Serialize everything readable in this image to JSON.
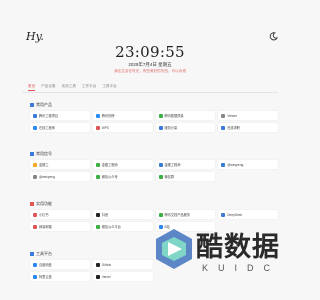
{
  "header": {
    "logo_text": "Hy.",
    "theme_icon": "moon-icon",
    "time": "23:09:55",
    "date": "2025年7月4日 星期五",
    "slogan": "我往生自在时光，有些美好的东西，可以永恒"
  },
  "tabs": [
    {
      "label": "首页",
      "active": true
    },
    {
      "label": "产品合集"
    },
    {
      "label": "实用工具"
    },
    {
      "label": "工作平台"
    },
    {
      "label": "工具平台"
    }
  ],
  "sections": [
    {
      "title": "常用产品",
      "color": "#3a7bd5",
      "items": [
        {
          "label": "腾讯工程项目",
          "color": "#3a7bd5"
        },
        {
          "label": "腾讯热榜",
          "color": "#2b8af7"
        },
        {
          "label": "腾讯数据质量",
          "color": "#3cb043"
        },
        {
          "label": "Viewer",
          "color": "#888888"
        },
        {
          "label": "在线工程师",
          "color": "#2b8af7"
        },
        {
          "label": "WPS",
          "color": "#e05555"
        },
        {
          "label": "服务计量",
          "color": "#3a7bd5"
        },
        {
          "label": "在线求职",
          "color": "#3a7bd5"
        }
      ]
    },
    {
      "title": "常用信号",
      "color": "#3a7bd5",
      "items": [
        {
          "label": "金蝶工",
          "color": "#f5a623"
        },
        {
          "label": "金蝶工程师",
          "color": "#3cb043"
        },
        {
          "label": "金蝶工程师",
          "color": "#3a7bd5"
        },
        {
          "label": "@wespeng",
          "color": "#3a7bd5"
        },
        {
          "label": "@wespeng",
          "color": "#888888"
        },
        {
          "label": "微信公众号",
          "color": "#3cb043"
        },
        {
          "label": "微信群",
          "color": "#3cb043"
        },
        {
          "label": "",
          "color": ""
        }
      ]
    },
    {
      "title": "实用功能",
      "color": "#e05555",
      "items": [
        {
          "label": "小红书",
          "color": "#e05555"
        },
        {
          "label": "抖音",
          "color": "#222222"
        },
        {
          "label": "腾讯文档产品服务",
          "color": "#3cb043"
        },
        {
          "label": "DeepSeek",
          "color": "#3a7bd5"
        },
        {
          "label": "网易邮箱",
          "color": "#e05555"
        },
        {
          "label": "微信公众平台",
          "color": "#3cb043"
        },
        {
          "label": "B站",
          "color": "#2b8af7"
        },
        {
          "label": "",
          "color": ""
        }
      ]
    },
    {
      "title": "工具平台",
      "color": "#3a7bd5",
      "items": [
        {
          "label": "百度网盘",
          "color": "#2b8af7"
        },
        {
          "label": "Github",
          "color": "#222222"
        },
        {
          "label": "",
          "color": ""
        },
        {
          "label": "",
          "color": ""
        },
        {
          "label": "阿里云盘",
          "color": "#2b8af7"
        },
        {
          "label": "Vercel",
          "color": "#222222"
        },
        {
          "label": "",
          "color": ""
        },
        {
          "label": "",
          "color": ""
        }
      ]
    }
  ],
  "watermark": {
    "text": "酷数据",
    "sub": "KUIDC"
  }
}
